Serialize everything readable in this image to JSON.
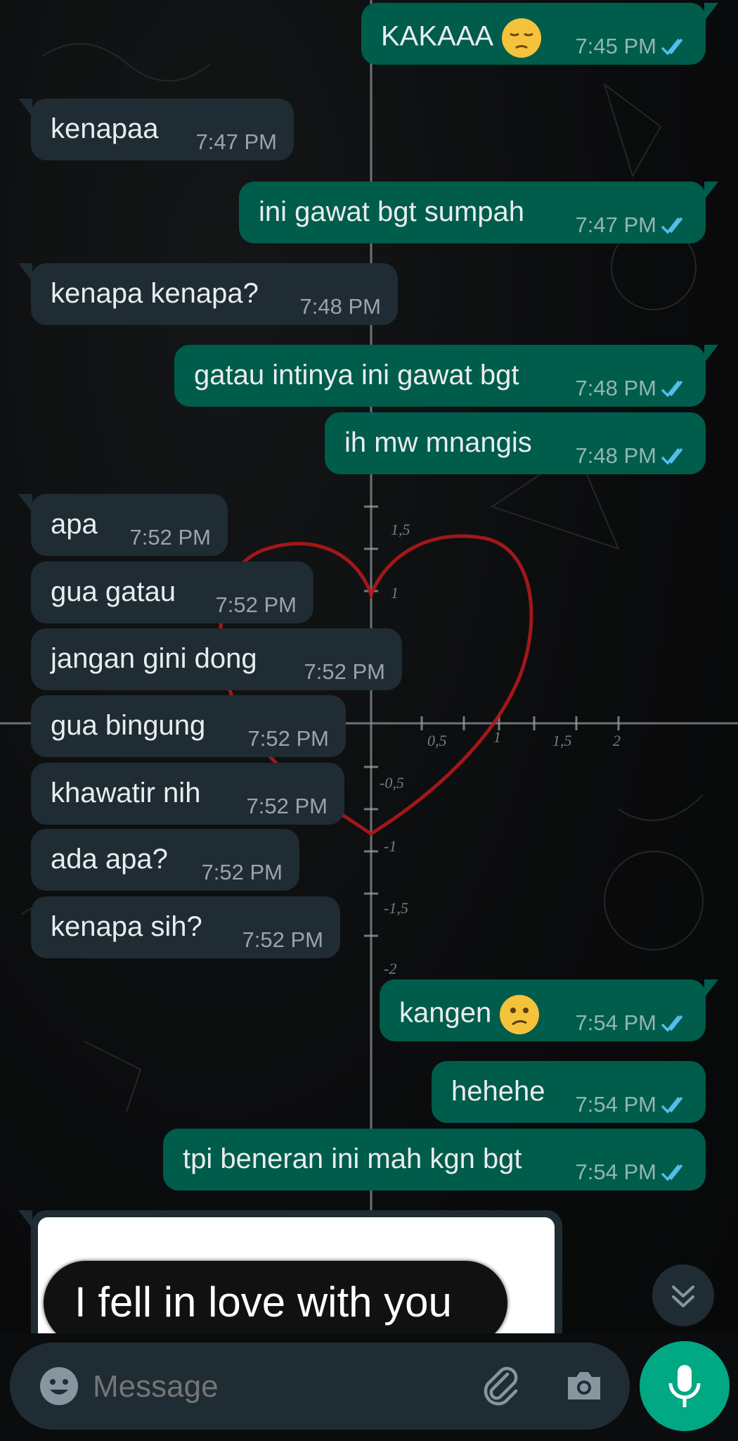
{
  "colors": {
    "background": "#0b0c0d",
    "incoming_bubble": "#1f2c33",
    "outgoing_bubble": "#005c4b",
    "read_ticks": "#53bdeb",
    "heart": "#b3181b",
    "mic_button": "#00a884"
  },
  "wallpaper": {
    "description_icons": [
      "heart-curve-icon"
    ],
    "axis_ticks": [
      "0,5",
      "1",
      "1,5",
      "2",
      "1,5",
      "1",
      "-0,5",
      "-1",
      "-1,5",
      "-2"
    ]
  },
  "messages": [
    {
      "dir": "out",
      "text": "KAKAAA",
      "emoji": "pensive-face-icon",
      "time": "7:45 PM",
      "status": "read"
    },
    {
      "dir": "in",
      "text": "kenapaa",
      "time": "7:47 PM"
    },
    {
      "dir": "out",
      "text": "ini gawat bgt sumpah",
      "time": "7:47 PM",
      "status": "read"
    },
    {
      "dir": "in",
      "text": "kenapa kenapa?",
      "time": "7:48 PM"
    },
    {
      "dir": "out",
      "text": "gatau intinya ini gawat bgt",
      "time": "7:48 PM",
      "status": "read"
    },
    {
      "dir": "out",
      "text": "ih mw mnangis",
      "time": "7:48 PM",
      "status": "read"
    },
    {
      "dir": "in",
      "text": "apa",
      "time": "7:52 PM"
    },
    {
      "dir": "in",
      "text": "gua gatau",
      "time": "7:52 PM"
    },
    {
      "dir": "in",
      "text": "jangan gini dong",
      "time": "7:52 PM"
    },
    {
      "dir": "in",
      "text": "gua bingung",
      "time": "7:52 PM"
    },
    {
      "dir": "in",
      "text": "khawatir nih",
      "time": "7:52 PM"
    },
    {
      "dir": "in",
      "text": "ada apa?",
      "time": "7:52 PM"
    },
    {
      "dir": "in",
      "text": "kenapa sih?",
      "time": "7:52 PM"
    },
    {
      "dir": "out",
      "text": "kangen",
      "emoji": "confused-face-icon",
      "time": "7:54 PM",
      "status": "read"
    },
    {
      "dir": "out",
      "text": "hehehe",
      "time": "7:54 PM",
      "status": "read"
    },
    {
      "dir": "out",
      "text": "tpi beneran ini mah kgn bgt",
      "time": "7:54 PM",
      "status": "read"
    }
  ],
  "image_message": {
    "dir": "in",
    "caption_in_image": "I fell in love with you"
  },
  "composer": {
    "placeholder": "Message",
    "icons": [
      "emoji-icon",
      "attach-icon",
      "camera-icon",
      "mic-icon"
    ]
  },
  "scroll_button": {
    "icon": "double-chevron-down-icon"
  }
}
